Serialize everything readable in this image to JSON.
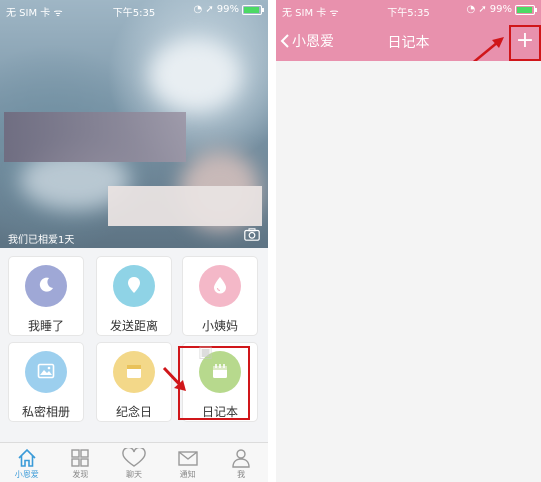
{
  "status_bar": {
    "carrier": "无 SIM 卡",
    "time": "下午5:35",
    "battery": "99%",
    "battery_level": 0.99
  },
  "left_screen": {
    "hero_caption": "我们已相爱1天",
    "features": [
      {
        "label": "我睡了",
        "color": "#9fa8d6",
        "icon": "moon-icon"
      },
      {
        "label": "发送距离",
        "color": "#8fd3e6",
        "icon": "location-icon"
      },
      {
        "label": "小姨妈",
        "color": "#f4b8c8",
        "icon": "drop-icon"
      },
      {
        "label": "私密相册",
        "color": "#9ccfee",
        "icon": "photo-icon"
      },
      {
        "label": "纪念日",
        "color": "#f3d889",
        "icon": "calendar-icon"
      },
      {
        "label": "日记本",
        "color": "#b7d98d",
        "icon": "notebook-icon"
      }
    ],
    "tabs": [
      {
        "label": "小恩爱",
        "icon": "home-icon"
      },
      {
        "label": "发现",
        "icon": "grid-icon"
      },
      {
        "label": "聊天",
        "icon": "heart-icon"
      },
      {
        "label": "通知",
        "icon": "mail-icon"
      },
      {
        "label": "我",
        "icon": "person-icon"
      }
    ]
  },
  "right_screen": {
    "back_label": "小恩爱",
    "title": "日记本",
    "add_label": "+"
  },
  "colors": {
    "nav_pink": "#e891ad",
    "highlight_red": "#d0161a",
    "active_tab": "#3b9bd8"
  }
}
